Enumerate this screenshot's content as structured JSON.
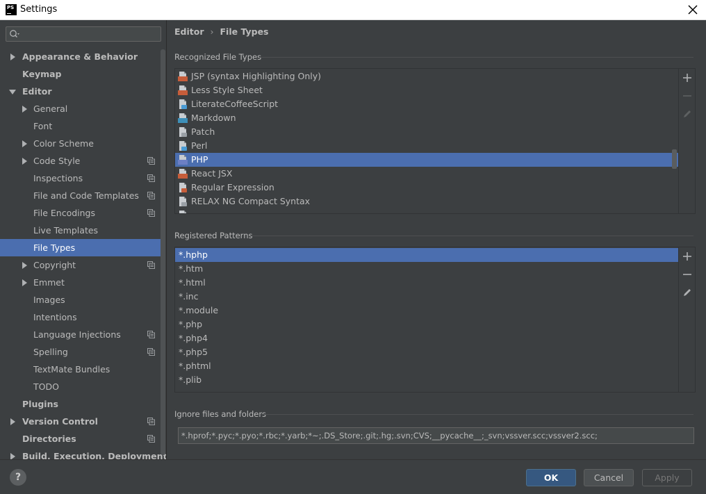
{
  "window": {
    "title": "Settings"
  },
  "search": {
    "placeholder": ""
  },
  "tree": [
    {
      "label": "Appearance & Behavior",
      "level": 0,
      "arrow": "right",
      "bold": true,
      "proj": false,
      "selected": false
    },
    {
      "label": "Keymap",
      "level": 0,
      "arrow": "none",
      "bold": true,
      "proj": false,
      "selected": false
    },
    {
      "label": "Editor",
      "level": 0,
      "arrow": "down",
      "bold": true,
      "proj": false,
      "selected": false
    },
    {
      "label": "General",
      "level": 1,
      "arrow": "right",
      "bold": false,
      "proj": false,
      "selected": false
    },
    {
      "label": "Font",
      "level": 1,
      "arrow": "none",
      "bold": false,
      "proj": false,
      "selected": false
    },
    {
      "label": "Color Scheme",
      "level": 1,
      "arrow": "right",
      "bold": false,
      "proj": false,
      "selected": false
    },
    {
      "label": "Code Style",
      "level": 1,
      "arrow": "right",
      "bold": false,
      "proj": true,
      "selected": false
    },
    {
      "label": "Inspections",
      "level": 1,
      "arrow": "none",
      "bold": false,
      "proj": true,
      "selected": false
    },
    {
      "label": "File and Code Templates",
      "level": 1,
      "arrow": "none",
      "bold": false,
      "proj": true,
      "selected": false
    },
    {
      "label": "File Encodings",
      "level": 1,
      "arrow": "none",
      "bold": false,
      "proj": true,
      "selected": false
    },
    {
      "label": "Live Templates",
      "level": 1,
      "arrow": "none",
      "bold": false,
      "proj": false,
      "selected": false
    },
    {
      "label": "File Types",
      "level": 1,
      "arrow": "none",
      "bold": false,
      "proj": false,
      "selected": true
    },
    {
      "label": "Copyright",
      "level": 1,
      "arrow": "right",
      "bold": false,
      "proj": true,
      "selected": false
    },
    {
      "label": "Emmet",
      "level": 1,
      "arrow": "right",
      "bold": false,
      "proj": false,
      "selected": false
    },
    {
      "label": "Images",
      "level": 1,
      "arrow": "none",
      "bold": false,
      "proj": false,
      "selected": false
    },
    {
      "label": "Intentions",
      "level": 1,
      "arrow": "none",
      "bold": false,
      "proj": false,
      "selected": false
    },
    {
      "label": "Language Injections",
      "level": 1,
      "arrow": "none",
      "bold": false,
      "proj": true,
      "selected": false
    },
    {
      "label": "Spelling",
      "level": 1,
      "arrow": "none",
      "bold": false,
      "proj": true,
      "selected": false
    },
    {
      "label": "TextMate Bundles",
      "level": 1,
      "arrow": "none",
      "bold": false,
      "proj": false,
      "selected": false
    },
    {
      "label": "TODO",
      "level": 1,
      "arrow": "none",
      "bold": false,
      "proj": false,
      "selected": false
    },
    {
      "label": "Plugins",
      "level": 0,
      "arrow": "none",
      "bold": true,
      "proj": false,
      "selected": false
    },
    {
      "label": "Version Control",
      "level": 0,
      "arrow": "right",
      "bold": true,
      "proj": true,
      "selected": false
    },
    {
      "label": "Directories",
      "level": 0,
      "arrow": "none",
      "bold": true,
      "proj": true,
      "selected": false
    },
    {
      "label": "Build, Execution, Deployment",
      "level": 0,
      "arrow": "right",
      "bold": true,
      "proj": false,
      "selected": false
    }
  ],
  "breadcrumb": {
    "parent": "Editor",
    "current": "File Types"
  },
  "recognized": {
    "label": "Recognized File Types",
    "items": [
      {
        "label": "JSP (syntax Highlighting Only)",
        "icon_text": "JSP",
        "icon_color": "#c65d3a",
        "selected": false
      },
      {
        "label": "Less Style Sheet",
        "icon_text": "LSS",
        "icon_color": "#c65d3a",
        "selected": false
      },
      {
        "label": "LiterateCoffeeScript",
        "icon_text": "",
        "icon_color": "#4a9bd4",
        "selected": false
      },
      {
        "label": "Markdown",
        "icon_text": "MD",
        "icon_color": "#3d8fb8",
        "selected": false
      },
      {
        "label": "Patch",
        "icon_text": "",
        "icon_color": "#9aa0a6",
        "selected": false
      },
      {
        "label": "Perl",
        "icon_text": "",
        "icon_color": "#4a9bd4",
        "selected": false
      },
      {
        "label": "PHP",
        "icon_text": "PHP",
        "icon_color": "#6c7fc4",
        "selected": true
      },
      {
        "label": "React JSX",
        "icon_text": "JSX",
        "icon_color": "#c65d3a",
        "selected": false
      },
      {
        "label": "Regular Expression",
        "icon_text": "",
        "icon_color": "#c65d3a",
        "selected": false
      },
      {
        "label": "RELAX NG Compact Syntax",
        "icon_text": "",
        "icon_color": "#9aa0a6",
        "selected": false
      },
      {
        "label": "",
        "icon_text": "",
        "icon_color": "#9aa0a6",
        "selected": false
      }
    ]
  },
  "patterns": {
    "label": "Registered Patterns",
    "items": [
      "*.hphp",
      "*.htm",
      "*.html",
      "*.inc",
      "*.module",
      "*.php",
      "*.php4",
      "*.php5",
      "*.phtml",
      "*.plib"
    ],
    "selected_index": 0
  },
  "ignore": {
    "label": "Ignore files and folders",
    "value": "*.hprof;*.pyc;*.pyo;*.rbc;*.yarb;*~;.DS_Store;.git;.hg;.svn;CVS;__pycache__;_svn;vssver.scc;vssver2.scc;"
  },
  "buttons": {
    "help": "?",
    "ok": "OK",
    "cancel": "Cancel",
    "apply": "Apply"
  },
  "colors": {
    "accent": "#4b6eaf",
    "background": "#3c3f41",
    "ok_button": "#365880"
  }
}
